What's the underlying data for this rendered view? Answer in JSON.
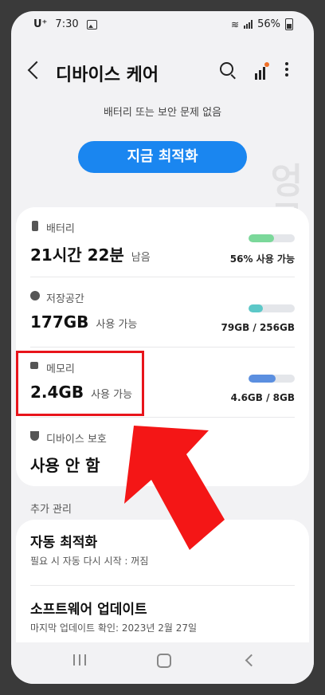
{
  "status_bar": {
    "carrier": "U⁺",
    "time": "7:30",
    "battery": "56%"
  },
  "header": {
    "title": "디바이스 케어"
  },
  "status_message": "배터리 또는 보안 문제 없음",
  "optimize_button": "지금 최적화",
  "care_items": [
    {
      "label": "배터리",
      "value": "21시간 22분",
      "unit": "남음",
      "right": "56% 사용 가능",
      "bar_fraction": 0.56,
      "bar_color": "#7bd89a"
    },
    {
      "label": "저장공간",
      "value": "177GB",
      "unit": "사용 가능",
      "right": "79GB / 256GB",
      "bar_fraction": 0.31,
      "bar_color": "#5cc8c8"
    },
    {
      "label": "메모리",
      "value": "2.4GB",
      "unit": "사용 가능",
      "right": "4.6GB / 8GB",
      "bar_fraction": 0.58,
      "bar_color": "#5b8fe0"
    },
    {
      "label": "디바이스 보호",
      "value": "사용 안 함"
    }
  ],
  "section_title": "추가 관리",
  "extra_items": [
    {
      "title": "자동 최적화",
      "subtitle": "필요 시 자동 다시 시작 : 꺼짐"
    },
    {
      "title": "소프트웨어 업데이트",
      "subtitle": "마지막 업데이트 확인: 2023년 2월 27일"
    }
  ],
  "watermark": "엉클샘의행사료실",
  "colors": {
    "accent": "#1a86f0",
    "highlight": "#e8141b"
  }
}
